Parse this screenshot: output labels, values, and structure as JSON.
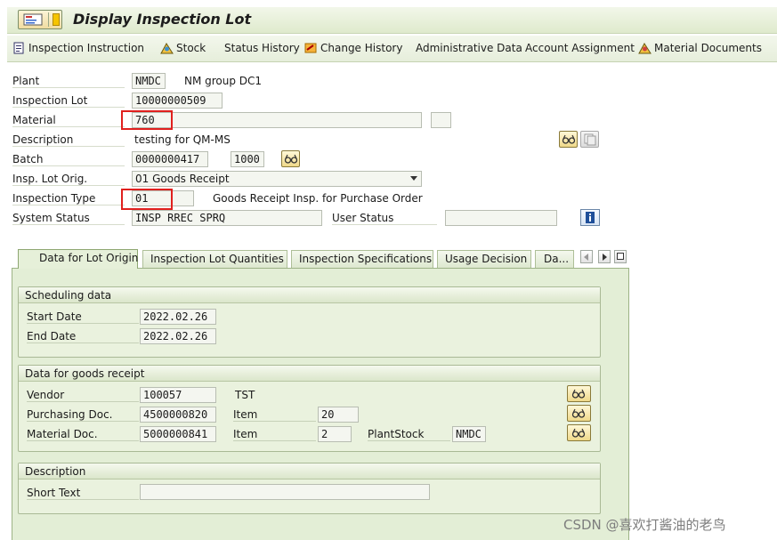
{
  "title": "Display Inspection Lot",
  "toolbar": {
    "inspection_instruction": "Inspection Instruction",
    "stock": "Stock",
    "status_history": "Status History",
    "change_history": "Change History",
    "administrative_data": "Administrative Data",
    "account_assignment": "Account Assignment",
    "material_documents": "Material Documents"
  },
  "header": {
    "plant_label": "Plant",
    "plant_value": "NMDC",
    "plant_desc": "NM group DC1",
    "inspection_lot_label": "Inspection Lot",
    "inspection_lot_value": "10000000509",
    "material_label": "Material",
    "material_value": "760",
    "description_label": "Description",
    "description_value": "testing for QM-MS",
    "batch_label": "Batch",
    "batch_value": "0000000417",
    "batch_plant_value": "1000",
    "lot_origin_label": "Insp. Lot Orig.",
    "lot_origin_value": "01 Goods Receipt",
    "inspection_type_label": "Inspection Type",
    "inspection_type_value": "01",
    "inspection_type_desc": "Goods Receipt Insp. for Purchase Order",
    "system_status_label": "System Status",
    "system_status_value": "INSP RREC SPRQ",
    "user_status_label": "User Status",
    "user_status_value": ""
  },
  "tabs": [
    {
      "label": "Data for Lot Origin",
      "active": true
    },
    {
      "label": "Inspection Lot Quantities",
      "active": false
    },
    {
      "label": "Inspection Specifications",
      "active": false
    },
    {
      "label": "Usage Decision",
      "active": false
    },
    {
      "label": "Da...",
      "active": false
    }
  ],
  "scheduling": {
    "title": "Scheduling data",
    "start_label": "Start Date",
    "start_value": "2022.02.26",
    "end_label": "End Date",
    "end_value": "2022.02.26"
  },
  "goods_receipt": {
    "title": "Data for goods receipt",
    "vendor_label": "Vendor",
    "vendor_value": "100057",
    "vendor_name": "TST",
    "purchasing_doc_label": "Purchasing Doc.",
    "purchasing_doc_value": "4500000820",
    "item_label": "Item",
    "purchasing_item_value": "20",
    "material_doc_label": "Material Doc.",
    "material_doc_value": "5000000841",
    "material_item_value": "2",
    "plant_stock_label": "PlantStock",
    "plant_stock_value": "NMDC"
  },
  "description_group": {
    "title": "Description",
    "short_text_label": "Short Text",
    "short_text_value": ""
  },
  "watermark": "CSDN @喜欢打酱油的老鸟",
  "colors": {
    "highlight": "#e0201e",
    "panel_bg": "#e3eed6",
    "toolbar_bg": "#e6eedb"
  }
}
